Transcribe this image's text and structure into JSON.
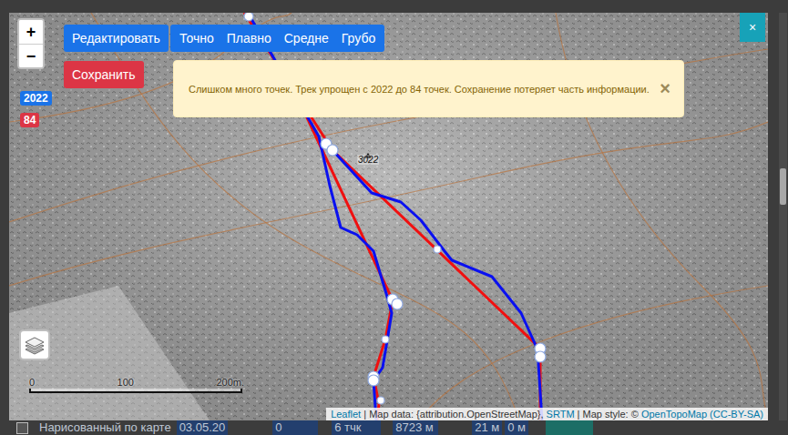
{
  "map": {
    "zoom": [
      {
        "label": "+"
      },
      {
        "label": "−"
      }
    ],
    "toolbar": {
      "edit": "Редактировать",
      "modes": [
        {
          "label": "Точно",
          "selected": false
        },
        {
          "label": "Плавно",
          "selected": false
        },
        {
          "label": "Средне",
          "selected": false
        },
        {
          "label": "Грубо",
          "selected": false
        }
      ],
      "save": "Сохранить"
    },
    "badges": [
      {
        "text": "2022",
        "color": "#1a73e8"
      },
      {
        "text": "84",
        "color": "#dc3545"
      }
    ],
    "alert": {
      "text": "Слишком много точек. Трек упрощен с 2022 до 84 точек. Сохранение потеряет часть информации.",
      "close": "×"
    },
    "close": "×",
    "peak_label": "3022",
    "scale": [
      "0",
      "100",
      "200m."
    ],
    "attribution": [
      {
        "text": "Leaflet",
        "link": true
      },
      {
        "text": " | Map data: {attribution.OpenStreetMap}, ",
        "link": false
      },
      {
        "text": "SRTM",
        "link": true
      },
      {
        "text": " | Map style: © ",
        "link": false
      },
      {
        "text": "OpenTopoMap (CC-BY-SA)",
        "link": true
      }
    ]
  },
  "background_row": {
    "checked": false,
    "cells": [
      {
        "text": "Нарисованный по карте",
        "highlight": false
      },
      {
        "text": "03.05.20",
        "highlight": true
      },
      {
        "text": "0",
        "highlight": true
      },
      {
        "text": "6 тчк",
        "highlight": true
      },
      {
        "text": "8723 м",
        "highlight": true
      },
      {
        "text": "21 м",
        "highlight": true
      },
      {
        "text": "0 м",
        "highlight": true
      }
    ]
  }
}
